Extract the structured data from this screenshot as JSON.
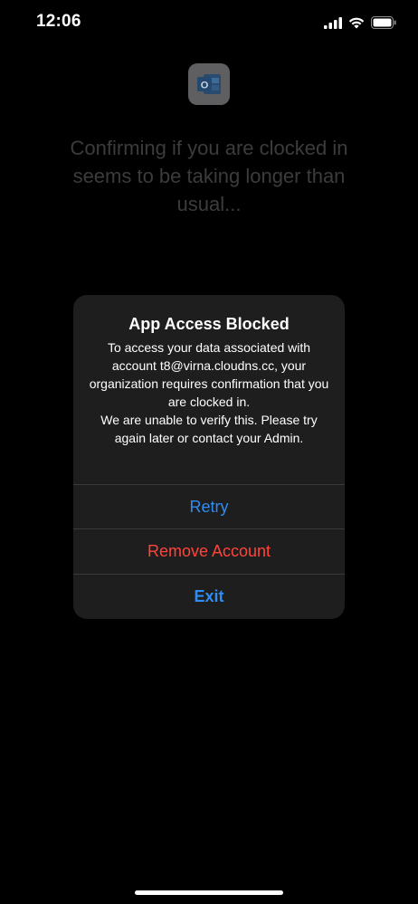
{
  "status_bar": {
    "time": "12:06",
    "icons": [
      "signal-icon",
      "wifi-icon",
      "battery-icon"
    ]
  },
  "background": {
    "app_icon": "outlook-icon",
    "app_icon_letter": "O",
    "loading_message": "Confirming if you are clocked in seems to be taking longer than usual..."
  },
  "alert": {
    "title": "App Access Blocked",
    "message_line1": "To access your data associated with account t8@virna.cloudns.cc, your organization requires confirmation that you are clocked in.",
    "message_line2": "We are unable to verify this. Please try again later or contact your Admin.",
    "actions": {
      "retry": "Retry",
      "remove_account": "Remove Account",
      "exit": "Exit"
    }
  },
  "colors": {
    "accent_blue": "#2f8cf0",
    "destructive_red": "#ff453a",
    "alert_background": "#1e1e1f",
    "dimmed_text": "#3c3c3e"
  }
}
